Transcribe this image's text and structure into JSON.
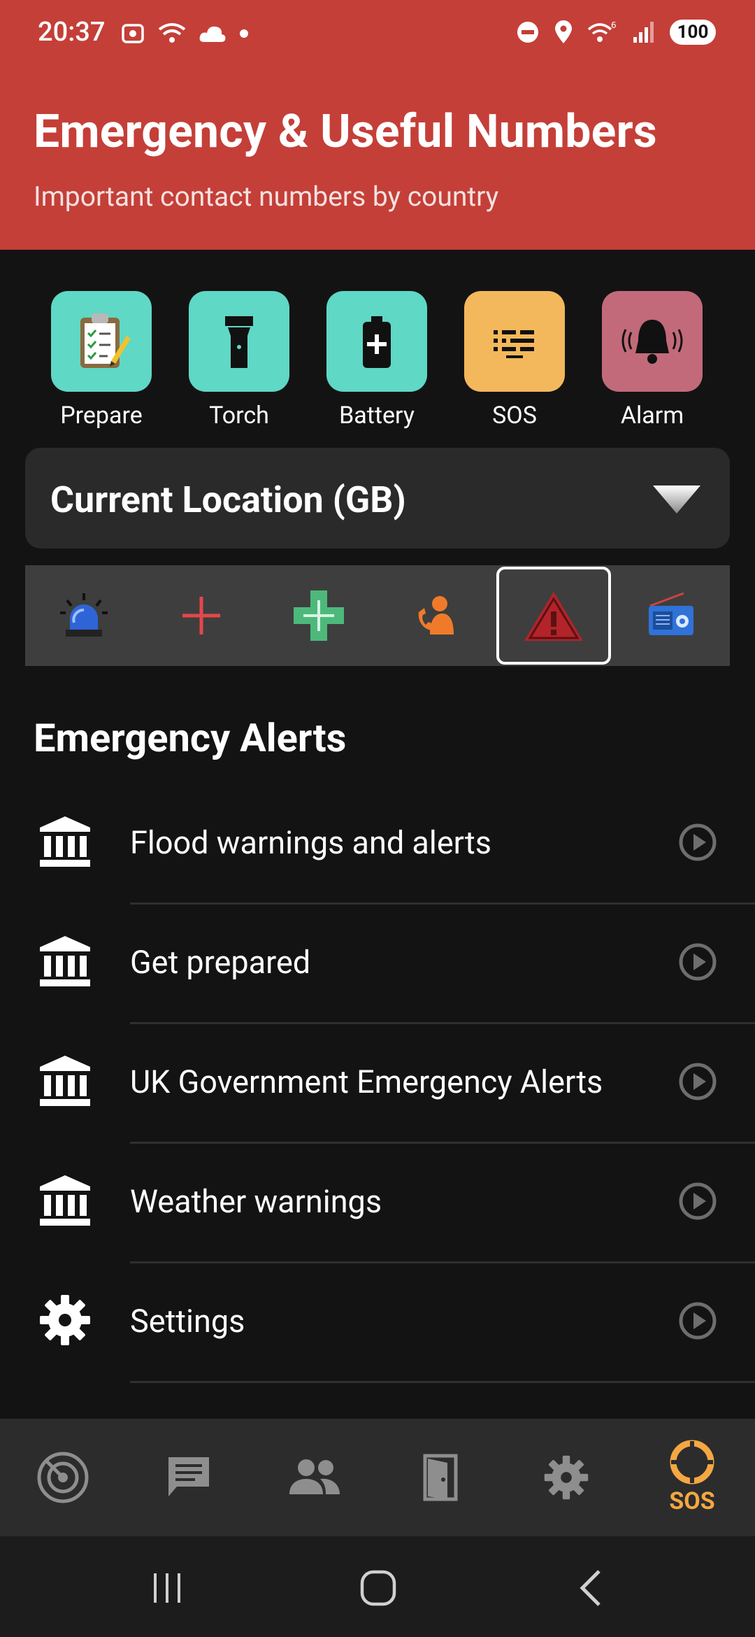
{
  "status_bar": {
    "time": "20:37",
    "battery": "100"
  },
  "header": {
    "title": "Emergency & Useful Numbers",
    "subtitle": "Important contact numbers by country"
  },
  "tools": [
    {
      "label": "Prepare",
      "icon": "clipboard-checklist-icon",
      "color": "#5fd8c5"
    },
    {
      "label": "Torch",
      "icon": "flashlight-icon",
      "color": "#5fd8c5"
    },
    {
      "label": "Battery",
      "icon": "battery-icon",
      "color": "#5fd8c5"
    },
    {
      "label": "SOS",
      "icon": "morse-code-icon",
      "color": "#f3b85b"
    },
    {
      "label": "Alarm",
      "icon": "ringing-bell-icon",
      "color": "#c26a7a"
    }
  ],
  "location": {
    "label": "Current Location (GB)"
  },
  "categories": [
    {
      "icon": "siren-icon",
      "selected": false
    },
    {
      "icon": "red-cross-icon",
      "selected": false
    },
    {
      "icon": "green-cross-icon",
      "selected": false
    },
    {
      "icon": "phone-person-icon",
      "selected": false
    },
    {
      "icon": "warning-triangle-icon",
      "selected": true
    },
    {
      "icon": "radio-icon",
      "selected": false
    }
  ],
  "section": {
    "title": "Emergency Alerts"
  },
  "list": [
    {
      "label": "Flood warnings and alerts",
      "icon": "government-building-icon"
    },
    {
      "label": "Get prepared",
      "icon": "government-building-icon"
    },
    {
      "label": "UK Government Emergency Alerts",
      "icon": "government-building-icon"
    },
    {
      "label": "Weather warnings",
      "icon": "government-building-icon"
    },
    {
      "label": "Settings",
      "icon": "gear-icon"
    }
  ],
  "bottom_nav": {
    "active_label": "SOS",
    "active_color": "#f5a742",
    "items": [
      "radar-icon",
      "chat-icon",
      "people-icon",
      "door-icon",
      "gear-icon",
      "lifebuoy-icon"
    ]
  },
  "colors": {
    "header_bg": "#c43f38",
    "page_bg": "#131313"
  }
}
